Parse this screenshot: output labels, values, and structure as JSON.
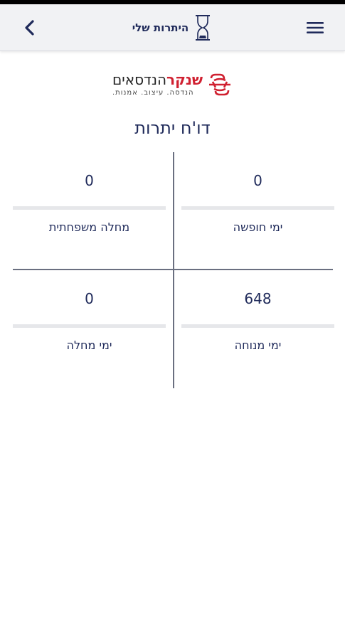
{
  "header": {
    "title": "היתרות שלי",
    "back_icon": "chevron-left-icon",
    "menu_icon": "hamburger-menu-icon",
    "title_icon": "hourglass-icon"
  },
  "logo": {
    "name_accent": "שנקר",
    "name_rest": "הנדסאים",
    "tagline": "הנדסה. עיצוב. אמנות."
  },
  "report": {
    "title": "דו'ח יתרות"
  },
  "balances": [
    {
      "label": "ימי חופשה",
      "value": "0"
    },
    {
      "label": "מחלה משפחתית",
      "value": "0"
    },
    {
      "label": "ימי מנוחה",
      "value": "648"
    },
    {
      "label": "ימי מחלה",
      "value": "0"
    }
  ],
  "colors": {
    "primary_text": "#1f2a5a",
    "header_bg": "#f1f2f4",
    "logo_accent": "#d02030"
  }
}
